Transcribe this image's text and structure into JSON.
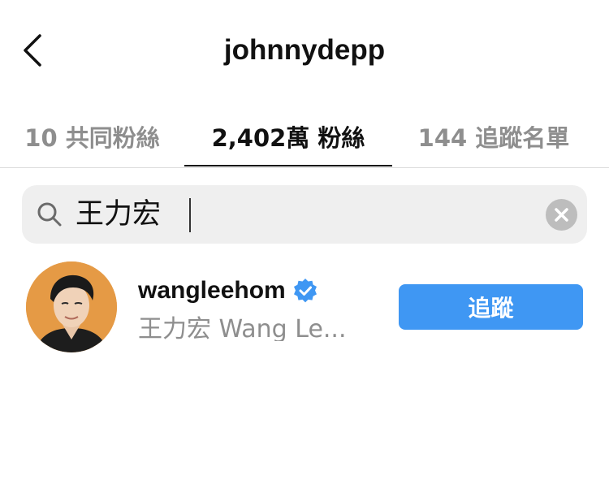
{
  "header": {
    "title": "johnnydepp"
  },
  "tabs": [
    {
      "label": "10 共同粉絲",
      "active": false
    },
    {
      "label": "2,402萬 粉絲",
      "active": true
    },
    {
      "label": "144 追蹤名單",
      "active": false
    }
  ],
  "search": {
    "value": "王力宏",
    "icon": "search-icon",
    "clear_icon": "clear-icon"
  },
  "results": [
    {
      "username": "wangleehom",
      "verified": true,
      "full_name": "王力宏 Wang Le...",
      "follow_label": "追蹤"
    }
  ],
  "colors": {
    "accent": "#3f97f3",
    "verified_badge": "#3f97f3",
    "secondary_text": "#8e8e8e",
    "search_bg": "#efefef"
  }
}
